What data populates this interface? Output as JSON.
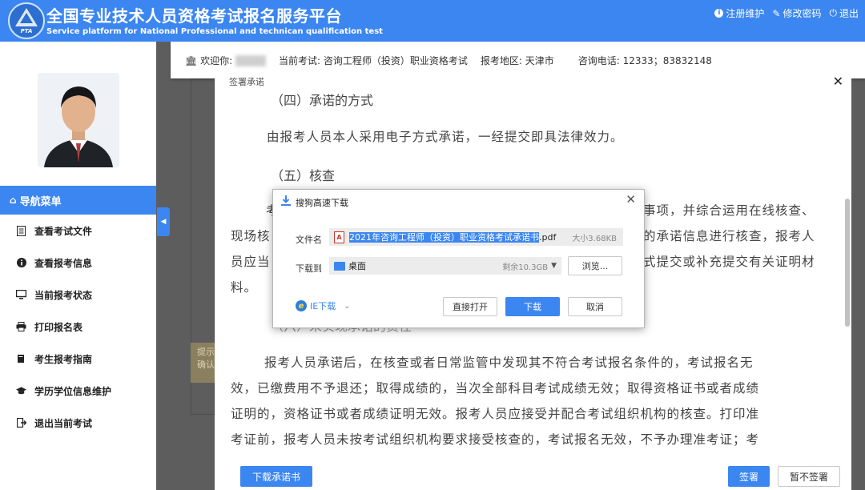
{
  "header": {
    "logo_text": "PTA",
    "title": "全国专业技术人员资格考试报名服务平台",
    "subtitle": "Service platform for National Professional and technican qualification test",
    "links": [
      {
        "icon": "info-icon",
        "label": "注册维护"
      },
      {
        "icon": "edit-icon",
        "label": "修改密码"
      },
      {
        "icon": "power-icon",
        "label": "退出"
      }
    ]
  },
  "info_bar": {
    "welcome_label": "欢迎你:",
    "exam_label": "当前考试:",
    "exam_value": "咨询工程师（投资）职业资格考试",
    "region_label": "报考地区:",
    "region_value": "天津市",
    "phone_label": "咨询电话:",
    "phone_value": "12333；83832148"
  },
  "sidebar": {
    "nav_title": "导航菜单",
    "items": [
      {
        "icon": "document-icon",
        "label": "查看考试文件"
      },
      {
        "icon": "info-circle-icon",
        "label": "查看报考信息"
      },
      {
        "icon": "monitor-icon",
        "label": "当前报考状态"
      },
      {
        "icon": "printer-icon",
        "label": "打印报名表"
      },
      {
        "icon": "book-icon",
        "label": "考生报考指南"
      },
      {
        "icon": "graduation-cap-icon",
        "label": "学历学位信息维护"
      },
      {
        "icon": "sign-out-icon",
        "label": "退出当前考试"
      }
    ]
  },
  "background_note": {
    "line1": "提示",
    "line2": "确认"
  },
  "promise_modal": {
    "title": "签署承诺",
    "heading_method": "（四）承诺的方式",
    "para_method": "由报考人员本人采用电子方式承诺，一经提交即具法律效力。",
    "heading_check": "（五）核查",
    "para_check_line1_start": "考",
    "para_check_line1_end": "事项，并综合运用在线核查、",
    "para_check_line2_start": "现场核",
    "para_check_line2_end": "的承诺信息进行核查，报考人",
    "para_check_line3_start": "员应当",
    "para_check_line3_end": "式提交或补充提交有关证明材",
    "para_check_line4": "料。",
    "heading_breach": "（六）未实现承诺的责任",
    "para_breach_lines": [
      "报考人员承诺后，在核查或者日常监管中发现其不符合考试报名条件的，考试报名无",
      "效，已缴费用不予退还；取得成绩的，当次全部科目考试成绩无效；取得资格证书或者成绩",
      "证明的，资格证书或者成绩证明无效。报考人员应接受并配合考试组织机构的核查。打印准",
      "考证前，报考人员未按考试组织机构要求接受核查的，考试报名无效，不予办理准考证；考"
    ],
    "download_button": "下载承诺书",
    "sign_button": "签署",
    "skip_button": "暂不签署"
  },
  "download_dialog": {
    "title": "搜狗高速下载",
    "filename_label": "文件名",
    "filename_selected": "2021年咨询工程师（投资）职业资格考试承诺书",
    "filename_ext": ".pdf",
    "file_size": "大小3.68KB",
    "save_to_label": "下载到",
    "save_path": "桌面",
    "free_space": "剩余10.3GB",
    "browse_button": "浏览...",
    "ie_download": "IE下载",
    "open_button": "直接打开",
    "download_button": "下载",
    "cancel_button": "取消"
  }
}
